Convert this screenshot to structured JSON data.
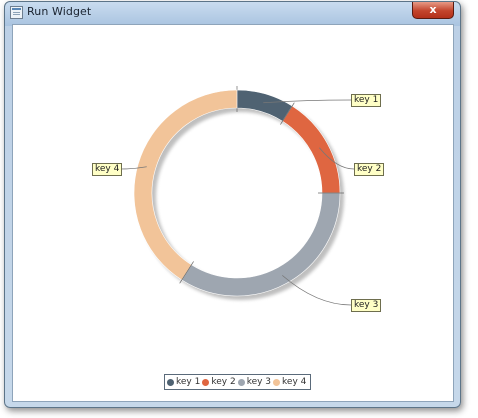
{
  "window": {
    "title": "Run Widget",
    "close_glyph": "x"
  },
  "chart_data": {
    "type": "pie",
    "subtype": "doughnut",
    "title": "",
    "series": [
      {
        "name": "key 1",
        "value": 9,
        "color": "#4f6272"
      },
      {
        "name": "key 2",
        "value": 16,
        "color": "#df6641"
      },
      {
        "name": "key 3",
        "value": 34,
        "color": "#9ea6b0"
      },
      {
        "name": "key 4",
        "value": 41,
        "color": "#f2c499"
      }
    ],
    "callouts": [
      "key 1",
      "key 2",
      "key 3",
      "key 4"
    ],
    "legend": {
      "placement": "bottom",
      "labels": [
        "key 1",
        "key 2",
        "key 3",
        "key 4"
      ]
    }
  }
}
